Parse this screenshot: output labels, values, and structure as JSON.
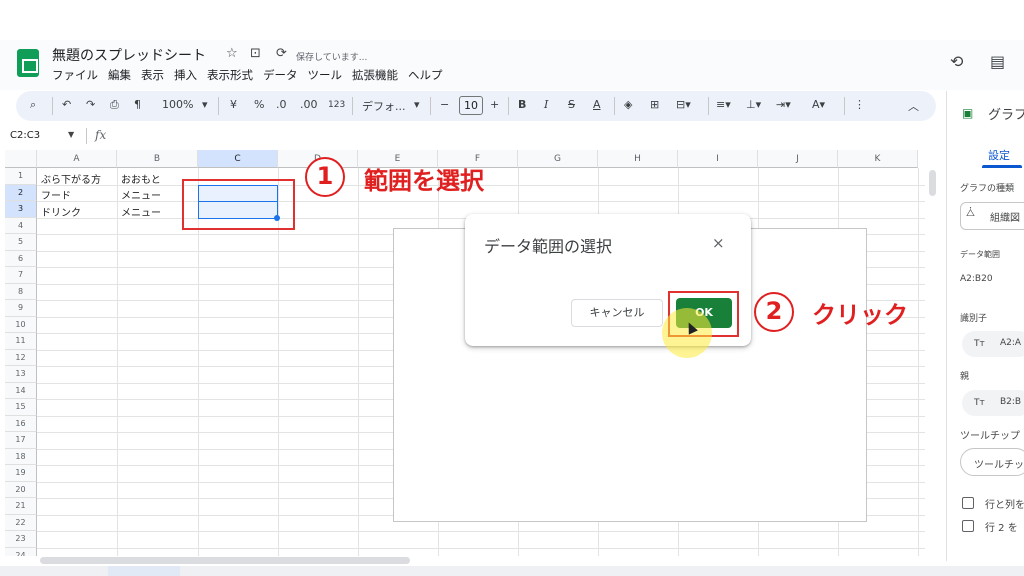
{
  "header": {
    "title": "無題のスプレッドシート",
    "save_status": "保存しています...",
    "menus": [
      "ファイル",
      "編集",
      "表示",
      "挿入",
      "表示形式",
      "データ",
      "ツール",
      "拡張機能",
      "ヘルプ"
    ]
  },
  "toolbar": {
    "zoom": "100%",
    "currency": "¥",
    "percent": "%",
    "dec_decrease": ".0",
    "dec_increase": ".00",
    "number_format": "123",
    "font": "デフォ...",
    "font_size": "10",
    "bold": "B",
    "italic": "I",
    "strike": "S",
    "text_color": "A"
  },
  "formula_bar": {
    "name_box": "C2:C3",
    "fx": "fx"
  },
  "grid": {
    "columns": [
      "A",
      "B",
      "C",
      "D",
      "E",
      "F",
      "G",
      "H",
      "I",
      "J",
      "K"
    ],
    "rows": [
      "1",
      "2",
      "3",
      "4",
      "5",
      "6",
      "7",
      "8",
      "9",
      "10",
      "11",
      "12",
      "13",
      "14",
      "15",
      "16",
      "17",
      "18",
      "19",
      "20",
      "21",
      "22",
      "23",
      "24"
    ],
    "cells": {
      "a1": "ぶら下がる方",
      "b1": "おおもと",
      "a2": "フード",
      "b2": "メニュー",
      "a3": "ドリンク",
      "b3": "メニュー"
    }
  },
  "dialog": {
    "title": "データ範囲の選択",
    "close": "×",
    "cancel_label": "キャンセル",
    "ok_label": "OK"
  },
  "annotations": {
    "step1_num": "1",
    "step1_text": "範囲を選択",
    "step2_num": "2",
    "step2_text": "クリック"
  },
  "side_panel": {
    "title": "グラフ",
    "tab_setup": "設定",
    "chart_type_label": "グラフの種類",
    "chart_type_value": "組織図",
    "data_range_label": "データ範囲",
    "data_range_value": "A2:B20",
    "identifier_label": "識別子",
    "identifier_value": "A2:A",
    "parent_label": "親",
    "parent_value": "B2:B",
    "tooltip_label": "ツールチップ",
    "tooltip_value": "ツールチッ",
    "checkbox1": "行と列を",
    "checkbox2": "行 2 を"
  },
  "colors": {
    "accent": "#1a73e8",
    "ok_button": "#188038",
    "annotation_red": "#e02020",
    "toolbar_bg": "#edf2fa"
  }
}
